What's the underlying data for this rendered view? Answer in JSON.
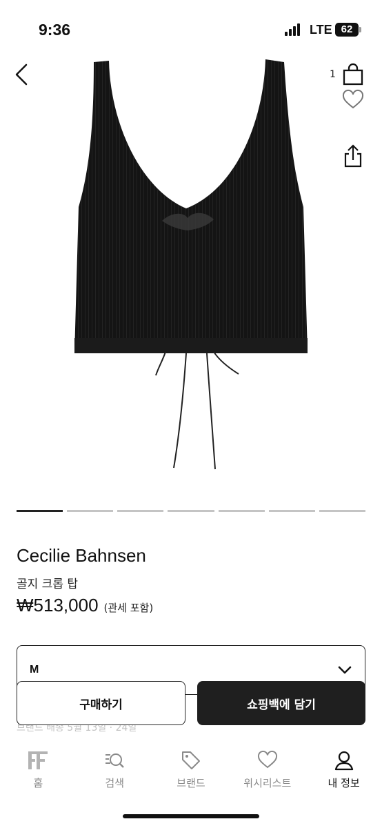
{
  "status_bar": {
    "time": "9:36",
    "network": "LTE",
    "battery": "62"
  },
  "header": {
    "cart_count": "1"
  },
  "carousel": {
    "total": 7,
    "active_index": 0
  },
  "product": {
    "brand": "Cecilie Bahnsen",
    "name": "골지 크롭 탑",
    "price": "₩513,000",
    "price_note": "(관세 포함)"
  },
  "size_select": {
    "value": "M"
  },
  "shipping_info": "브랜드 배송 5월 13일 · 24일",
  "actions": {
    "buy_label": "구매하기",
    "bag_label": "쇼핑백에 담기"
  },
  "tabs": [
    {
      "label": "홈",
      "icon": "ff-logo-icon"
    },
    {
      "label": "검색",
      "icon": "search-icon"
    },
    {
      "label": "브랜드",
      "icon": "tag-icon"
    },
    {
      "label": "위시리스트",
      "icon": "heart-icon"
    },
    {
      "label": "내 정보",
      "icon": "user-icon"
    }
  ],
  "colors": {
    "accent": "#1f1f1f",
    "inactive_tab": "#8a8a8a",
    "indicator_inactive": "#c4c4c4"
  }
}
